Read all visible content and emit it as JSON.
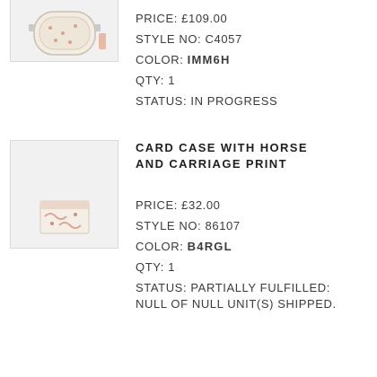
{
  "orders": [
    {
      "price": "PRICE: £109.00",
      "style_label": "STYLE NO:",
      "style_value": "C4057",
      "color_label": "COLOR:",
      "color_value": "IMM6H",
      "qty": "QTY: 1",
      "status": "STATUS: IN PROGRESS",
      "image_icon": "camera-bag-product-icon"
    },
    {
      "title": "CARD CASE WITH HORSE AND CARRIAGE PRINT",
      "price": "PRICE: £32.00",
      "style_label": "STYLE NO:",
      "style_value": "86107",
      "color_label": "COLOR:",
      "color_value": "B4RGL",
      "qty": "QTY: 1",
      "status": "STATUS: PARTIALLY FULFILLED: NULL OF NULL UNIT(S) SHIPPED.",
      "image_icon": "card-case-product-icon"
    }
  ],
  "colors": {
    "thumb_bg": "#f1f1f1",
    "text": "#3b3b3b",
    "title": "#1f1f1f"
  }
}
